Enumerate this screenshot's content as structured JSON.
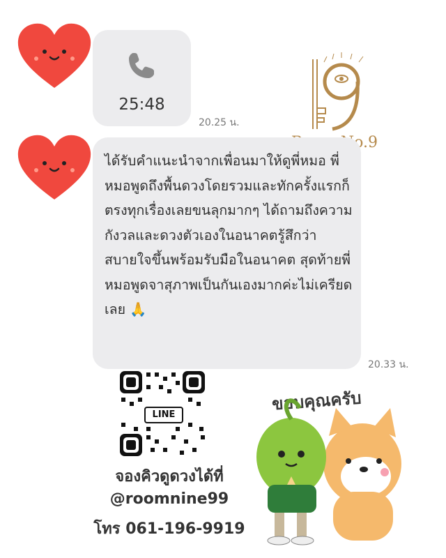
{
  "call": {
    "duration": "25:48",
    "time": "20.25 น."
  },
  "message": {
    "text": "ได้รับคำแนะนำจากเพื่อนมาให้ดูพี่หมอ พี่หมอพูดถึงพื้นดวงโดยรวมและทักครั้งแรกก็ตรงทุกเรื่องเลยขนลุกมากๆ ได้ถามถึงความกังวลและดวงตัวเองในอนาคตรู้สึกว่าสบายใจขึ้นพร้อมรับมือในอนาคต สุดท้ายพี่หมอพูดจาสุภาพเป็นกันเองมากค่ะไม่เครียดเลย",
    "emoji": "🙏",
    "time": "20.33 น."
  },
  "logo": {
    "text": "Room No.9"
  },
  "qr": {
    "badge": "LINE"
  },
  "contact": {
    "line1": "จองคิวดูดวงได้ที่",
    "line2": "@roomnine99",
    "line3": "โทร 061-196-9919"
  },
  "sticker": {
    "text": "ขอบคุณครับ"
  },
  "colors": {
    "heart": "#f0483e",
    "bubble": "#ececee",
    "gold": "#b58a4c"
  }
}
